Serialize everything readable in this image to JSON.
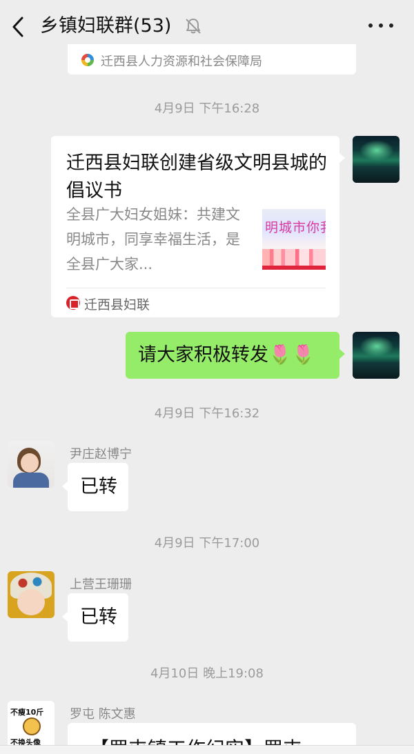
{
  "header": {
    "title": "乡镇妇联群(53)"
  },
  "previous_card": {
    "source": "迁西县人力资源和社会保障局"
  },
  "messages": {
    "time1": "4月9日 下午16:28",
    "link": {
      "title": "迁西县妇联创建省级文明县城的倡议书",
      "description": "全县广大妇女姐妹：共建文明城市，同享幸福生活，是全县广大家...",
      "thumb_text": "明城市你我",
      "source": "迁西县妇联"
    },
    "self_text": "请大家积极转发🌷🌷",
    "time2": "4月9日 下午16:32",
    "msg1": {
      "sender": "尹庄赵博宁",
      "text": "已转"
    },
    "time3": "4月9日 下午17:00",
    "msg2": {
      "sender": "上营王珊珊",
      "text": "已转"
    },
    "time4": "4月10日 晚上19:08",
    "msg3": {
      "sender": "罗屯 陈文惠",
      "avatar_top": "不瘦10斤",
      "avatar_bottom": "不换头像",
      "text": "【罗屯镇工作纪实】罗屯"
    }
  },
  "icons": {
    "back": "chevron-left-icon",
    "mute": "bell-off-icon",
    "more": "more-horizontal-icon"
  }
}
